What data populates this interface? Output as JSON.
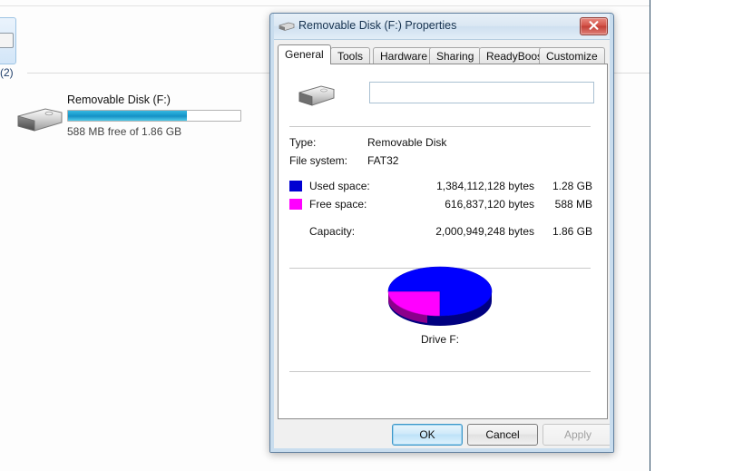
{
  "explorer": {
    "group_label": "(2)",
    "drive": {
      "name": "Removable Disk (F:)",
      "free_text": "588 MB free of 1.86 GB",
      "used_percent": 69,
      "bar_color": "#1b9ed0",
      "icon": "usb-flash-drive-icon"
    }
  },
  "dialog": {
    "title": "Removable Disk (F:) Properties",
    "title_icon": "usb-flash-drive-icon",
    "close_icon": "close-icon",
    "tabs": [
      {
        "label": "General",
        "active": true
      },
      {
        "label": "Tools",
        "active": false
      },
      {
        "label": "Hardware",
        "active": false
      },
      {
        "label": "Sharing",
        "active": false
      },
      {
        "label": "ReadyBoost",
        "active": false
      },
      {
        "label": "Customize",
        "active": false
      }
    ],
    "general": {
      "drive_icon": "usb-flash-drive-icon",
      "volume_label_value": "",
      "volume_label_placeholder": "",
      "type_label": "Type:",
      "type_value": "Removable Disk",
      "filesystem_label": "File system:",
      "filesystem_value": "FAT32",
      "used_label": "Used space:",
      "used_bytes": "1,384,112,128 bytes",
      "used_size": "1.28 GB",
      "used_color": "#0000d2",
      "free_label": "Free space:",
      "free_bytes": "616,837,120 bytes",
      "free_size": "588 MB",
      "free_color": "#ff00ff",
      "capacity_label": "Capacity:",
      "capacity_bytes": "2,000,949,248 bytes",
      "capacity_size": "1.86 GB",
      "drive_caption": "Drive F:"
    },
    "footer": {
      "ok_label": "OK",
      "cancel_label": "Cancel",
      "apply_label": "Apply"
    }
  },
  "chart_data": {
    "type": "pie",
    "title": "Drive F:",
    "labels": [
      "Used space",
      "Free space"
    ],
    "values": [
      1384112128,
      616837120
    ],
    "display_values": [
      "1.28 GB",
      "588 MB"
    ],
    "percentages": [
      69.2,
      30.8
    ],
    "colors": [
      "#0000ff",
      "#ff00ff"
    ],
    "side_colors": [
      "#000080",
      "#8b008b"
    ],
    "total": 2000949248,
    "total_display": "1.86 GB",
    "style": "3d-ellipse",
    "legend_position": "above-chart"
  }
}
